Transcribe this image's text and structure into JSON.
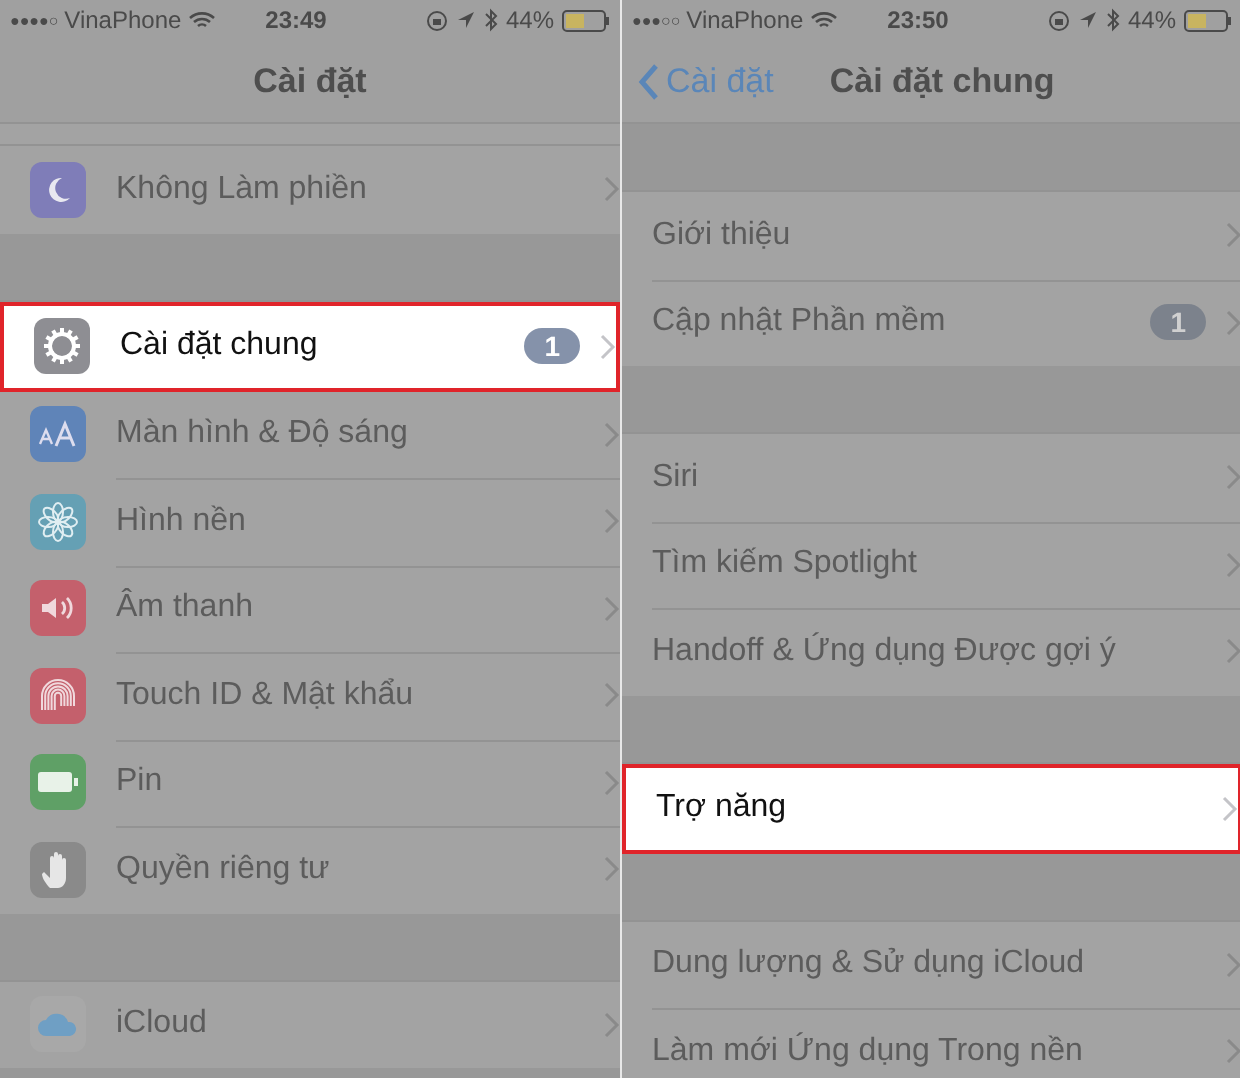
{
  "screens": [
    {
      "status_bar": {
        "signal": "●●●●○",
        "carrier": "VinaPhone",
        "time": "23:49",
        "battery": "44%"
      },
      "nav": {
        "title": "Cài đặt"
      },
      "scrolled": true,
      "sections": [
        {
          "rows": [
            {
              "label": "Không Làm phiền",
              "kind": "moon",
              "color": "#7f7db8",
              "highlighted": false
            }
          ]
        },
        {
          "rows": [
            {
              "label": "Cài đặt chung",
              "kind": "gear",
              "color": "#8e8e93",
              "badge": "1",
              "highlighted": true
            },
            {
              "label": "Màn hình & Độ sáng",
              "kind": "text-size",
              "color": "#5f84b8",
              "highlighted": false
            },
            {
              "label": "Hình nền",
              "kind": "flower",
              "color": "#65a0b4",
              "highlighted": false
            },
            {
              "label": "Âm thanh",
              "kind": "speaker",
              "color": "#c4606c",
              "highlighted": false
            },
            {
              "label": "Touch ID & Mật khẩu",
              "kind": "fingerprint",
              "color": "#c4606c",
              "highlighted": false
            },
            {
              "label": "Pin",
              "kind": "battery",
              "color": "#5fa066",
              "highlighted": false
            },
            {
              "label": "Quyền riêng tư",
              "kind": "hand",
              "color": "#8a8a8a",
              "highlighted": false
            }
          ]
        },
        {
          "rows": [
            {
              "label": "iCloud",
              "kind": "cloud",
              "color": "#6f9fc4",
              "highlighted": false
            }
          ]
        }
      ]
    },
    {
      "status_bar": {
        "signal": "●●●○○",
        "carrier": "VinaPhone",
        "time": "23:50",
        "battery": "44%"
      },
      "nav": {
        "back": "Cài đặt",
        "title": "Cài đặt chung"
      },
      "sections": [
        {
          "rows": [
            {
              "label": "Giới thiệu",
              "highlighted": false
            },
            {
              "label": "Cập nhật Phần mềm",
              "badge": "1",
              "highlighted": false
            }
          ]
        },
        {
          "rows": [
            {
              "label": "Siri",
              "highlighted": false
            },
            {
              "label": "Tìm kiếm Spotlight",
              "highlighted": false
            },
            {
              "label": "Handoff & Ứng dụng Được gợi ý",
              "highlighted": false
            }
          ]
        },
        {
          "rows": [
            {
              "label": "Trợ năng",
              "highlighted": true
            }
          ]
        },
        {
          "rows": [
            {
              "label": "Dung lượng & Sử dụng iCloud",
              "highlighted": false
            },
            {
              "label": "Làm mới Ứng dụng Trong nền",
              "highlighted": false
            }
          ]
        }
      ]
    }
  ]
}
